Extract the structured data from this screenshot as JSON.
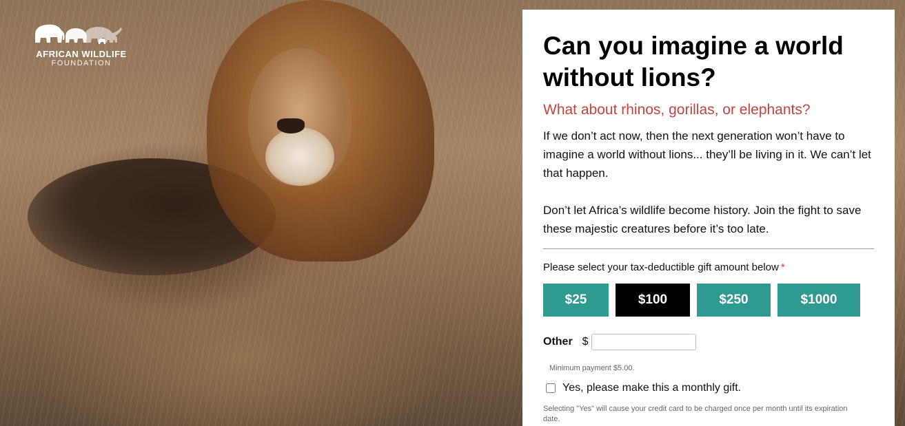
{
  "logo": {
    "line1": "AFRICAN WILDLIFE",
    "line2": "FOUNDATION",
    "icon": "elephant-herd-logo-icon"
  },
  "hero": {
    "image": "lion-photo"
  },
  "form": {
    "headline": "Can you imagine a world without lions?",
    "subhead": "What about rhinos, gorillas, or elephants?",
    "paragraph1": "If we don’t act now, then the next generation won’t have to imagine a world without lions... they’ll be living in it. We can’t let that happen.",
    "paragraph2": "Don’t let Africa’s wildlife become history. Join the fight to save these majestic creatures before it’s too late.",
    "gift_label": "Please select your tax-deductible gift amount below",
    "required_mark": "*",
    "amounts": [
      "$25",
      "$100",
      "$250",
      "$1000"
    ],
    "selected_amount": "$100",
    "other_label": "Other",
    "currency_symbol": "$",
    "other_value": "",
    "min_payment": "Minimum payment $5.00.",
    "monthly_label": "Yes, please make this a monthly gift.",
    "monthly_checked": false,
    "monthly_note": "Selecting \"Yes\" will cause your credit card to be charged once per month until its expiration date."
  },
  "colors": {
    "accent_teal": "#2f9a90",
    "selected_black": "#000000",
    "subhead_red": "#c0453b"
  }
}
